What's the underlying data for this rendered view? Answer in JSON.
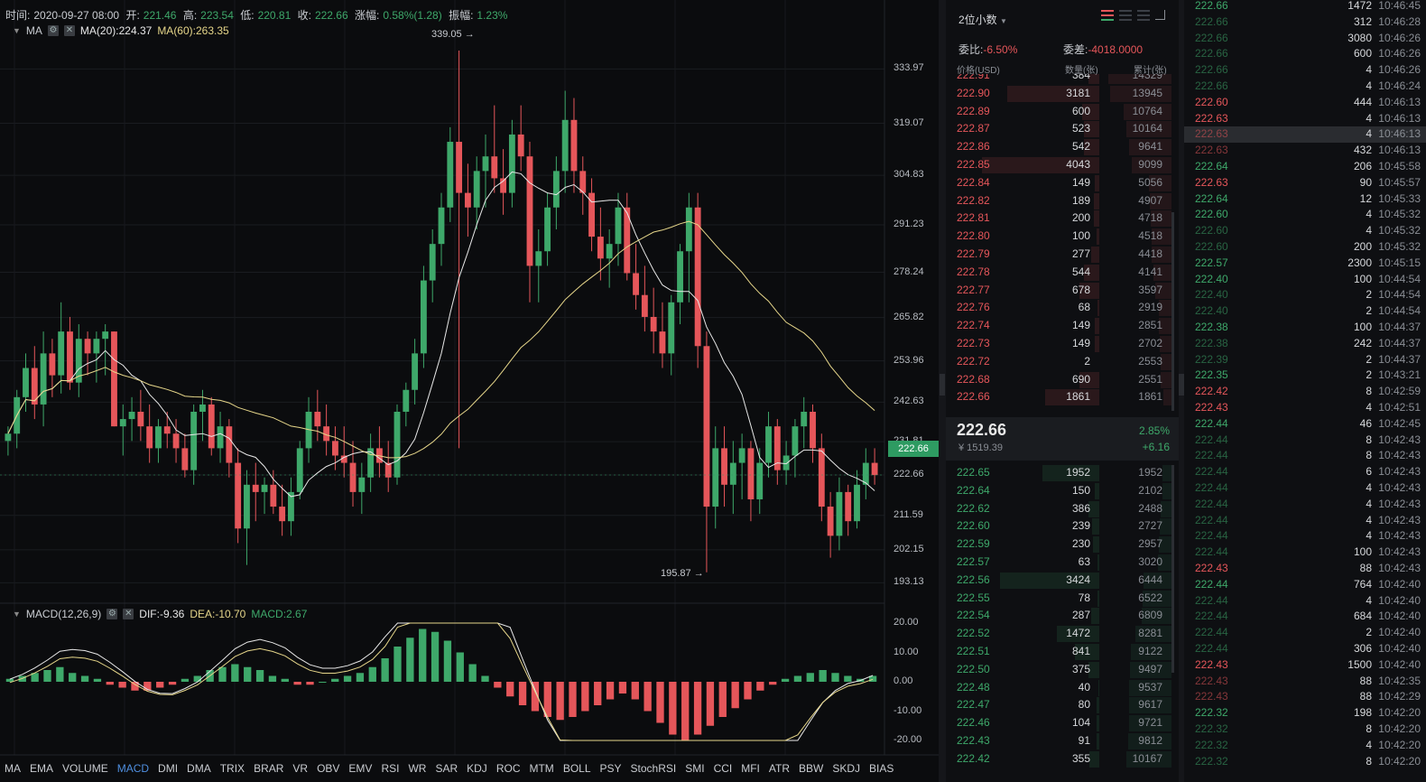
{
  "info": {
    "time_label": "时间:",
    "time_value": "2020-09-27 08:00",
    "open_label": "开:",
    "open_value": "221.46",
    "high_label": "高:",
    "high_value": "223.54",
    "low_label": "低:",
    "low_value": "220.81",
    "close_label": "收:",
    "close_value": "222.66",
    "chg_label": "涨幅:",
    "chg_value": "0.58%(1.28)",
    "amp_label": "振幅:",
    "amp_value": "1.23%"
  },
  "ma_row": {
    "name": "MA",
    "ma20": "MA(20):224.37",
    "ma60": "MA(60):263.35"
  },
  "macd_row": {
    "name": "MACD(12,26,9)",
    "dif": "DIF:-9.36",
    "dea": "DEA:-10.70",
    "macd": "MACD:2.67"
  },
  "price_axis": [
    "333.97",
    "319.07",
    "304.83",
    "291.23",
    "278.24",
    "265.82",
    "253.96",
    "242.63",
    "231.81",
    "222.66",
    "211.59",
    "202.15",
    "193.13"
  ],
  "macd_axis": [
    "20.00",
    "10.00",
    "0.00",
    "-10.00",
    "-20.00"
  ],
  "last_price": "222.66",
  "high_marker": "339.05 →",
  "low_marker": "195.87 →",
  "indicator_tabs": [
    "MA",
    "EMA",
    "VOLUME",
    "MACD",
    "DMI",
    "DMA",
    "TRIX",
    "BRAR",
    "VR",
    "OBV",
    "EMV",
    "RSI",
    "WR",
    "SAR",
    "KDJ",
    "ROC",
    "MTM",
    "BOLL",
    "PSY",
    "StochRSI",
    "SMI",
    "CCI",
    "MFI",
    "ATR",
    "BBW",
    "SKDJ",
    "BIAS"
  ],
  "active_tab": "MACD",
  "colors": {
    "up": "#3ea86a",
    "down": "#e5565a",
    "ma20": "#e8e8e8",
    "ma60": "#e6d68a",
    "accent": "#4f8fe0"
  },
  "chart_data": {
    "type": "candlestick",
    "candles": [
      [
        232,
        236,
        228,
        234
      ],
      [
        234,
        246,
        230,
        244
      ],
      [
        244,
        256,
        240,
        252
      ],
      [
        252,
        258,
        238,
        242
      ],
      [
        242,
        262,
        236,
        256
      ],
      [
        256,
        260,
        244,
        250
      ],
      [
        250,
        270,
        245,
        262
      ],
      [
        262,
        266,
        246,
        248
      ],
      [
        248,
        264,
        244,
        260
      ],
      [
        260,
        262,
        250,
        256
      ],
      [
        256,
        262,
        248,
        260
      ],
      [
        260,
        264,
        250,
        262
      ],
      [
        262,
        262,
        236,
        236
      ],
      [
        236,
        242,
        228,
        238
      ],
      [
        238,
        244,
        232,
        240
      ],
      [
        240,
        246,
        232,
        236
      ],
      [
        236,
        242,
        226,
        230
      ],
      [
        230,
        238,
        226,
        236
      ],
      [
        236,
        240,
        230,
        234
      ],
      [
        234,
        238,
        226,
        230
      ],
      [
        230,
        234,
        222,
        224
      ],
      [
        224,
        242,
        220,
        240
      ],
      [
        240,
        246,
        232,
        242
      ],
      [
        242,
        244,
        228,
        230
      ],
      [
        230,
        240,
        226,
        236
      ],
      [
        236,
        238,
        222,
        226
      ],
      [
        226,
        230,
        204,
        208
      ],
      [
        208,
        224,
        198,
        220
      ],
      [
        220,
        226,
        210,
        218
      ],
      [
        218,
        222,
        212,
        220
      ],
      [
        220,
        224,
        212,
        214
      ],
      [
        214,
        220,
        206,
        210
      ],
      [
        210,
        222,
        206,
        218
      ],
      [
        218,
        232,
        216,
        230
      ],
      [
        230,
        244,
        226,
        240
      ],
      [
        240,
        246,
        232,
        236
      ],
      [
        236,
        242,
        228,
        232
      ],
      [
        232,
        236,
        224,
        228
      ],
      [
        228,
        236,
        222,
        226
      ],
      [
        226,
        232,
        214,
        218
      ],
      [
        218,
        226,
        212,
        222
      ],
      [
        222,
        234,
        218,
        230
      ],
      [
        230,
        236,
        222,
        226
      ],
      [
        226,
        232,
        218,
        222
      ],
      [
        222,
        242,
        220,
        240
      ],
      [
        240,
        248,
        236,
        246
      ],
      [
        246,
        260,
        242,
        256
      ],
      [
        256,
        280,
        252,
        276
      ],
      [
        276,
        290,
        270,
        286
      ],
      [
        286,
        300,
        280,
        296
      ],
      [
        296,
        318,
        292,
        314
      ],
      [
        314,
        339,
        230,
        300
      ],
      [
        300,
        308,
        288,
        296
      ],
      [
        296,
        310,
        290,
        306
      ],
      [
        306,
        316,
        296,
        310
      ],
      [
        310,
        324,
        300,
        304
      ],
      [
        304,
        312,
        294,
        300
      ],
      [
        300,
        320,
        296,
        316
      ],
      [
        316,
        324,
        306,
        310
      ],
      [
        310,
        314,
        270,
        280
      ],
      [
        280,
        290,
        270,
        284
      ],
      [
        284,
        300,
        280,
        296
      ],
      [
        296,
        310,
        290,
        306
      ],
      [
        306,
        328,
        300,
        320
      ],
      [
        320,
        326,
        300,
        306
      ],
      [
        306,
        310,
        294,
        300
      ],
      [
        300,
        304,
        284,
        288
      ],
      [
        288,
        296,
        276,
        282
      ],
      [
        282,
        290,
        274,
        286
      ],
      [
        286,
        300,
        280,
        296
      ],
      [
        296,
        300,
        276,
        278
      ],
      [
        278,
        286,
        268,
        272
      ],
      [
        272,
        280,
        262,
        266
      ],
      [
        266,
        274,
        256,
        262
      ],
      [
        262,
        270,
        252,
        256
      ],
      [
        256,
        272,
        250,
        270
      ],
      [
        270,
        286,
        264,
        284
      ],
      [
        284,
        300,
        270,
        296
      ],
      [
        296,
        300,
        252,
        258
      ],
      [
        258,
        262,
        196,
        214
      ],
      [
        214,
        236,
        208,
        230
      ],
      [
        230,
        236,
        214,
        220
      ],
      [
        220,
        232,
        212,
        226
      ],
      [
        226,
        234,
        216,
        230
      ],
      [
        230,
        232,
        210,
        216
      ],
      [
        216,
        230,
        212,
        226
      ],
      [
        226,
        240,
        222,
        236
      ],
      [
        236,
        238,
        220,
        224
      ],
      [
        224,
        232,
        220,
        228
      ],
      [
        228,
        238,
        222,
        236
      ],
      [
        236,
        244,
        230,
        240
      ],
      [
        240,
        242,
        226,
        230
      ],
      [
        230,
        234,
        210,
        214
      ],
      [
        214,
        218,
        200,
        206
      ],
      [
        206,
        222,
        202,
        218
      ],
      [
        218,
        220,
        206,
        210
      ],
      [
        210,
        224,
        208,
        220
      ],
      [
        220,
        230,
        216,
        226
      ],
      [
        226,
        230,
        220,
        222.66
      ]
    ],
    "ma20_visible": true,
    "ma60_visible": true,
    "ylim": [
      190,
      340
    ],
    "macd": {
      "hist_sample": [
        1,
        2,
        3,
        4,
        5,
        3,
        2,
        1,
        -1,
        -2,
        -3,
        -3,
        -2,
        -1,
        1,
        2,
        4,
        5,
        6,
        5,
        4,
        2,
        1,
        -1,
        -1,
        0,
        1,
        2,
        3,
        5,
        8,
        12,
        15,
        18,
        17,
        14,
        10,
        6,
        2,
        -2,
        -5,
        -8,
        -10,
        -12,
        -13,
        -12,
        -10,
        -8,
        -6,
        -4,
        -6,
        -10,
        -14,
        -18,
        -20,
        -18,
        -15,
        -12,
        -9,
        -6,
        -3,
        -1,
        1,
        2,
        3,
        4,
        3,
        2,
        1,
        2
      ],
      "ylim": [
        -20,
        20
      ]
    }
  },
  "book": {
    "precision": "2位小数",
    "ratio_label": "委比:",
    "ratio_value": "-6.50%",
    "diff_label": "委差:",
    "diff_value": "-4018.0000",
    "col_price": "价格(USD)",
    "col_qty": "数量(张)",
    "col_cum": "累计(张)",
    "asks": [
      [
        "222.91",
        "384",
        "14329"
      ],
      [
        "222.90",
        "3181",
        "13945"
      ],
      [
        "222.89",
        "600",
        "10764"
      ],
      [
        "222.87",
        "523",
        "10164"
      ],
      [
        "222.86",
        "542",
        "9641"
      ],
      [
        "222.85",
        "4043",
        "9099"
      ],
      [
        "222.84",
        "149",
        "5056"
      ],
      [
        "222.82",
        "189",
        "4907"
      ],
      [
        "222.81",
        "200",
        "4718"
      ],
      [
        "222.80",
        "100",
        "4518"
      ],
      [
        "222.79",
        "277",
        "4418"
      ],
      [
        "222.78",
        "544",
        "4141"
      ],
      [
        "222.77",
        "678",
        "3597"
      ],
      [
        "222.76",
        "68",
        "2919"
      ],
      [
        "222.74",
        "149",
        "2851"
      ],
      [
        "222.73",
        "149",
        "2702"
      ],
      [
        "222.72",
        "2",
        "2553"
      ],
      [
        "222.68",
        "690",
        "2551"
      ],
      [
        "222.66",
        "1861",
        "1861"
      ]
    ],
    "mid_price": "222.66",
    "mid_cny": "¥ 1519.39",
    "mid_change_pct": "2.85%",
    "mid_change": "+6.16",
    "bids": [
      [
        "222.65",
        "1952",
        "1952"
      ],
      [
        "222.64",
        "150",
        "2102"
      ],
      [
        "222.62",
        "386",
        "2488"
      ],
      [
        "222.60",
        "239",
        "2727"
      ],
      [
        "222.59",
        "230",
        "2957"
      ],
      [
        "222.57",
        "63",
        "3020"
      ],
      [
        "222.56",
        "3424",
        "6444"
      ],
      [
        "222.55",
        "78",
        "6522"
      ],
      [
        "222.54",
        "287",
        "6809"
      ],
      [
        "222.52",
        "1472",
        "8281"
      ],
      [
        "222.51",
        "841",
        "9122"
      ],
      [
        "222.50",
        "375",
        "9497"
      ],
      [
        "222.48",
        "40",
        "9537"
      ],
      [
        "222.47",
        "80",
        "9617"
      ],
      [
        "222.46",
        "104",
        "9721"
      ],
      [
        "222.43",
        "91",
        "9812"
      ],
      [
        "222.42",
        "355",
        "10167"
      ]
    ]
  },
  "trades": [
    [
      "222.66",
      "1472",
      "10:46:45",
      "up",
      false
    ],
    [
      "222.66",
      "312",
      "10:46:28",
      "up",
      true
    ],
    [
      "222.66",
      "3080",
      "10:46:26",
      "up",
      true
    ],
    [
      "222.66",
      "600",
      "10:46:26",
      "up",
      true
    ],
    [
      "222.66",
      "4",
      "10:46:26",
      "up",
      true
    ],
    [
      "222.66",
      "4",
      "10:46:24",
      "up",
      true
    ],
    [
      "222.60",
      "444",
      "10:46:13",
      "down",
      false
    ],
    [
      "222.63",
      "4",
      "10:46:13",
      "down",
      false
    ],
    [
      "222.63",
      "4",
      "10:46:13",
      "down",
      true
    ],
    [
      "222.63",
      "432",
      "10:46:13",
      "down",
      true
    ],
    [
      "222.64",
      "206",
      "10:45:58",
      "up",
      false
    ],
    [
      "222.63",
      "90",
      "10:45:57",
      "down",
      false
    ],
    [
      "222.64",
      "12",
      "10:45:33",
      "up",
      false
    ],
    [
      "222.60",
      "4",
      "10:45:32",
      "up",
      false
    ],
    [
      "222.60",
      "4",
      "10:45:32",
      "up",
      true
    ],
    [
      "222.60",
      "200",
      "10:45:32",
      "up",
      true
    ],
    [
      "222.57",
      "2300",
      "10:45:15",
      "up",
      false
    ],
    [
      "222.40",
      "100",
      "10:44:54",
      "up",
      false
    ],
    [
      "222.40",
      "2",
      "10:44:54",
      "up",
      true
    ],
    [
      "222.40",
      "2",
      "10:44:54",
      "up",
      true
    ],
    [
      "222.38",
      "100",
      "10:44:37",
      "up",
      false
    ],
    [
      "222.38",
      "242",
      "10:44:37",
      "up",
      true
    ],
    [
      "222.39",
      "2",
      "10:44:37",
      "up",
      true
    ],
    [
      "222.35",
      "2",
      "10:43:21",
      "up",
      false
    ],
    [
      "222.42",
      "8",
      "10:42:59",
      "down",
      false
    ],
    [
      "222.43",
      "4",
      "10:42:51",
      "down",
      false
    ],
    [
      "222.44",
      "46",
      "10:42:45",
      "up",
      false
    ],
    [
      "222.44",
      "8",
      "10:42:43",
      "up",
      true
    ],
    [
      "222.44",
      "8",
      "10:42:43",
      "up",
      true
    ],
    [
      "222.44",
      "6",
      "10:42:43",
      "up",
      true
    ],
    [
      "222.44",
      "4",
      "10:42:43",
      "up",
      true
    ],
    [
      "222.44",
      "4",
      "10:42:43",
      "up",
      true
    ],
    [
      "222.44",
      "4",
      "10:42:43",
      "up",
      true
    ],
    [
      "222.44",
      "4",
      "10:42:43",
      "up",
      true
    ],
    [
      "222.44",
      "100",
      "10:42:43",
      "up",
      true
    ],
    [
      "222.43",
      "88",
      "10:42:43",
      "down",
      false
    ],
    [
      "222.44",
      "764",
      "10:42:40",
      "up",
      false
    ],
    [
      "222.44",
      "4",
      "10:42:40",
      "up",
      true
    ],
    [
      "222.44",
      "684",
      "10:42:40",
      "up",
      true
    ],
    [
      "222.44",
      "2",
      "10:42:40",
      "up",
      true
    ],
    [
      "222.44",
      "306",
      "10:42:40",
      "up",
      true
    ],
    [
      "222.43",
      "1500",
      "10:42:40",
      "down",
      false
    ],
    [
      "222.43",
      "88",
      "10:42:35",
      "down",
      true
    ],
    [
      "222.43",
      "88",
      "10:42:29",
      "down",
      true
    ],
    [
      "222.32",
      "198",
      "10:42:20",
      "up",
      false
    ],
    [
      "222.32",
      "8",
      "10:42:20",
      "up",
      true
    ],
    [
      "222.32",
      "4",
      "10:42:20",
      "up",
      true
    ],
    [
      "222.32",
      "8",
      "10:42:20",
      "up",
      true
    ]
  ]
}
